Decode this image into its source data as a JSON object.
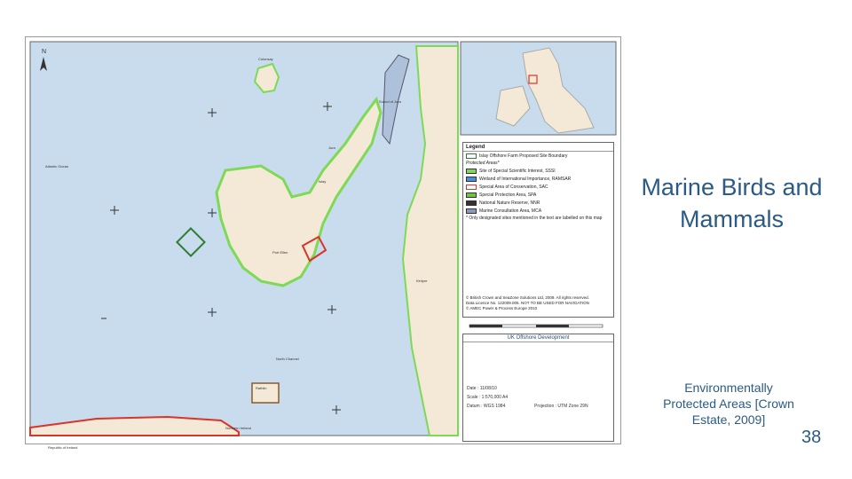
{
  "slide": {
    "heading": "Marine Birds and Mammals",
    "caption": "Environmentally Protected Areas [Crown Estate, 2009]",
    "page_number": "38"
  },
  "map": {
    "legend": {
      "title": "Legend",
      "items": [
        {
          "label": "Islay Offshore Farm Proposed Site Boundary",
          "color": "#2e7d32"
        },
        {
          "label": "Protected Areas*",
          "color": "none"
        },
        {
          "label": "Site of Special Scientific Interest, SSSI",
          "color": "#7ed957"
        },
        {
          "label": "Wetland of International Importance, RAMSAR",
          "color": "#4a90d9"
        },
        {
          "label": "Special Area of Conservation, SAC",
          "color": "#d9342b"
        },
        {
          "label": "Special Protection Area, SPA",
          "color": "#76c043"
        },
        {
          "label": "National Nature Reserve, NNR",
          "color": "#333333"
        },
        {
          "label": "Marine Consultation Area, MCA",
          "color": "#8899bb"
        }
      ],
      "footnote": "* Only designated sites mentioned in the text are labelled on this map",
      "copyright": [
        "© British Crown and SeaZone Solutions Ltd, 2009. All rights reserved.",
        "Data Licence No. 122009.005. NOT TO BE USED FOR NAVIGATION",
        "© AMEC Power & Process Europe 2010"
      ]
    },
    "title_block": {
      "header": "UK Offshore Development",
      "date": "Date : 11/08/10",
      "scale": "Scale : 1:570,000  A4",
      "datum": "Datum : WGS 1984",
      "projection": "Projection : UTM Zone 29N"
    },
    "place_labels": {
      "colonsay": "Colonsay",
      "jura": "Jura",
      "islay": "Islay",
      "kintyre": "Kintyre",
      "northern_ireland": "Northern Ireland",
      "republic_of_ireland": "Republic of Ireland",
      "atlantic": "Atlantic Ocean",
      "north_channel": "North Channel",
      "rathlin": "Rathlin",
      "port_ellen": "Port Ellen",
      "sound_of_jura": "Sound of Jura"
    },
    "colors": {
      "sea": "#c8dcee",
      "land": "#f3e9d6",
      "sssi": "#7ed957",
      "sac": "#d9342b"
    }
  }
}
